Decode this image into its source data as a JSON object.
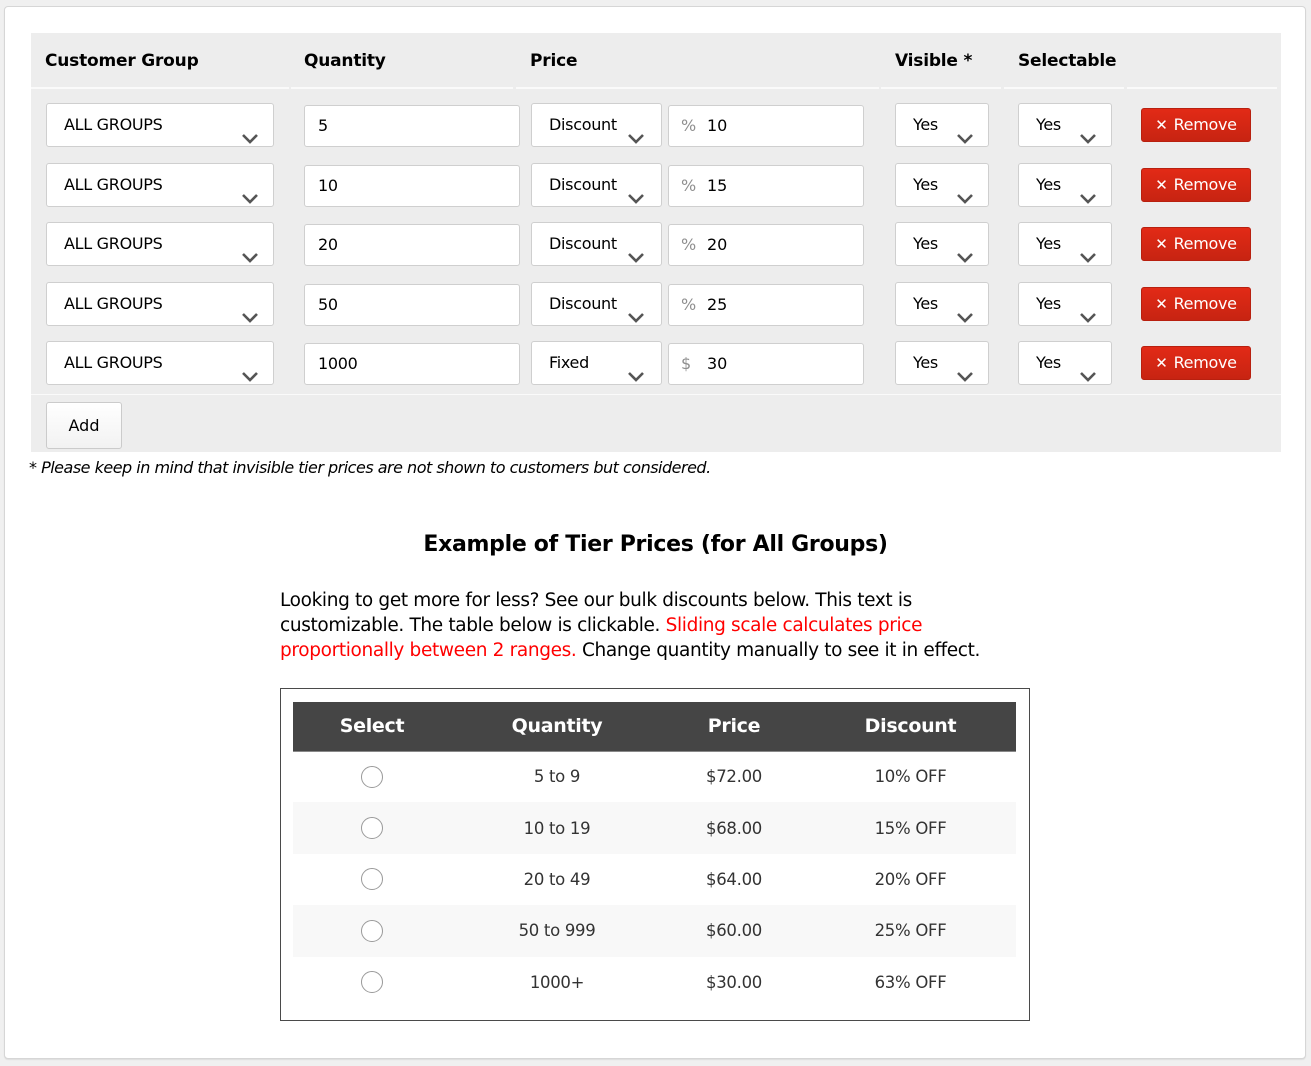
{
  "editor": {
    "headers": {
      "customer_group": "Customer Group",
      "quantity": "Quantity",
      "price": "Price",
      "visible": "Visible *",
      "selectable": "Selectable"
    },
    "rows": [
      {
        "group": "ALL GROUPS",
        "quantity": "5",
        "price_type": "Discount",
        "price_prefix": "%",
        "price_value": "10",
        "visible": "Yes",
        "selectable": "Yes",
        "remove_label": "Remove"
      },
      {
        "group": "ALL GROUPS",
        "quantity": "10",
        "price_type": "Discount",
        "price_prefix": "%",
        "price_value": "15",
        "visible": "Yes",
        "selectable": "Yes",
        "remove_label": "Remove"
      },
      {
        "group": "ALL GROUPS",
        "quantity": "20",
        "price_type": "Discount",
        "price_prefix": "%",
        "price_value": "20",
        "visible": "Yes",
        "selectable": "Yes",
        "remove_label": "Remove"
      },
      {
        "group": "ALL GROUPS",
        "quantity": "50",
        "price_type": "Discount",
        "price_prefix": "%",
        "price_value": "25",
        "visible": "Yes",
        "selectable": "Yes",
        "remove_label": "Remove"
      },
      {
        "group": "ALL GROUPS",
        "quantity": "1000",
        "price_type": "Fixed",
        "price_prefix": "$",
        "price_value": "30",
        "visible": "Yes",
        "selectable": "Yes",
        "remove_label": "Remove"
      }
    ],
    "remove_icon": "close-icon",
    "add_label": "Add"
  },
  "note": "* Please keep in mind that invisible tier prices are not shown to customers but considered.",
  "example": {
    "title": "Example of Tier Prices (for All Groups)",
    "desc_part1": "Looking to get more for less? See our bulk discounts below. This text is customizable. The table below is clickable. ",
    "desc_red": "Sliding scale calculates price proportionally between 2 ranges.",
    "desc_part2": " Change quantity manually to see it in effect.",
    "table": {
      "headers": [
        "Select",
        "Quantity",
        "Price",
        "Discount"
      ],
      "rows": [
        {
          "quantity": "5 to 9",
          "price": "$72.00",
          "discount": "10% OFF",
          "selected": false
        },
        {
          "quantity": "10 to 19",
          "price": "$68.00",
          "discount": "15% OFF",
          "selected": false
        },
        {
          "quantity": "20 to 49",
          "price": "$64.00",
          "discount": "20% OFF",
          "selected": false
        },
        {
          "quantity": "50 to 999",
          "price": "$60.00",
          "discount": "25% OFF",
          "selected": false
        },
        {
          "quantity": "1000+",
          "price": "$30.00",
          "discount": "63% OFF",
          "selected": false
        }
      ]
    }
  },
  "colors": {
    "remove_button": "#d9261a",
    "highlight_text": "#ff0000",
    "table_header": "#454545"
  }
}
